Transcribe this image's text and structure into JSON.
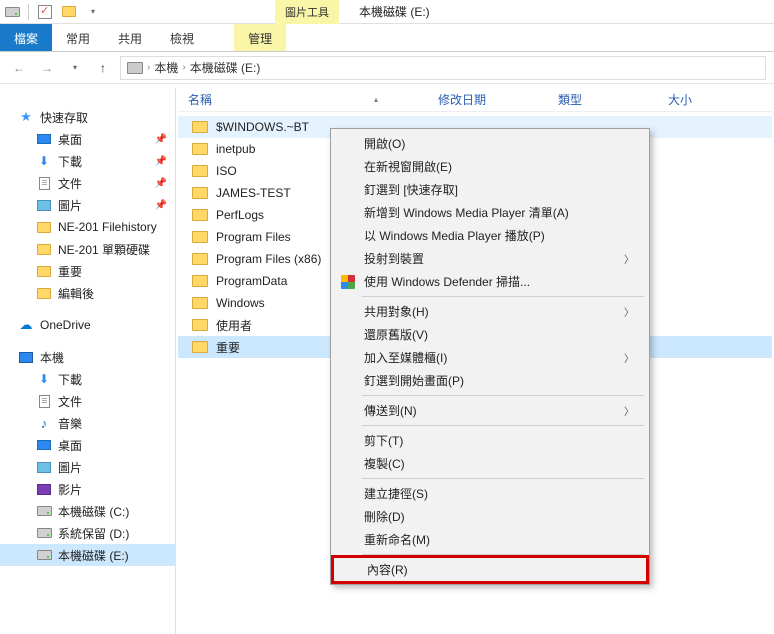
{
  "titlebar": {
    "tools_tab": "圖片工具",
    "window_title": "本機磁碟 (E:)"
  },
  "ribbon": {
    "file": "檔案",
    "home": "常用",
    "share": "共用",
    "view": "檢視",
    "manage": "管理"
  },
  "breadcrumb": {
    "pc": "本機",
    "drive": "本機磁碟 (E:)"
  },
  "columns": {
    "name": "名稱",
    "date": "修改日期",
    "type": "類型",
    "size": "大小"
  },
  "tree": {
    "quick_access": "快速存取",
    "desktop": "桌面",
    "downloads": "下載",
    "documents": "文件",
    "pictures": "圖片",
    "ne201_filehist": "NE-201 Filehistory",
    "ne201_single": "NE-201 單顆硬碟",
    "important": "重要",
    "edited": "編輯後",
    "onedrive": "OneDrive",
    "this_pc": "本機",
    "pc_downloads": "下載",
    "pc_documents": "文件",
    "pc_music": "音樂",
    "pc_desktop": "桌面",
    "pc_pictures": "圖片",
    "pc_videos": "影片",
    "drive_c": "本機磁碟 (C:)",
    "drive_d": "系統保留 (D:)",
    "drive_e": "本機磁碟 (E:)"
  },
  "files": [
    "$WINDOWS.~BT",
    "inetpub",
    "ISO",
    "JAMES-TEST",
    "PerfLogs",
    "Program Files",
    "Program Files (x86)",
    "ProgramData",
    "Windows",
    "使用者",
    "重要"
  ],
  "context_menu": {
    "open": "開啟(O)",
    "open_new_window": "在新視窗開啟(E)",
    "pin_quick": "釘選到 [快速存取]",
    "add_wmp_list": "新增到 Windows Media Player 清單(A)",
    "play_wmp": "以 Windows Media Player 播放(P)",
    "cast": "投射到裝置",
    "defender": "使用 Windows Defender 掃描...",
    "share_with": "共用對象(H)",
    "restore_prev": "還原舊版(V)",
    "include_lib": "加入至媒體櫃(I)",
    "pin_start": "釘選到開始畫面(P)",
    "send_to": "傳送到(N)",
    "cut": "剪下(T)",
    "copy": "複製(C)",
    "shortcut": "建立捷徑(S)",
    "delete": "刪除(D)",
    "rename": "重新命名(M)",
    "properties": "內容(R)"
  }
}
